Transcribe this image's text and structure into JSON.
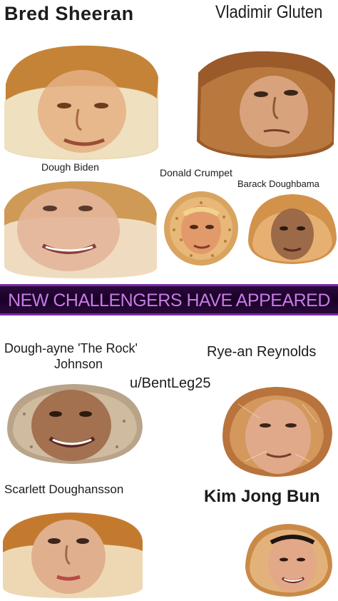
{
  "top": {
    "bred": "Bred Sheeran",
    "vladimir": "Vladimir Gluten",
    "dough_biden": "Dough Biden",
    "donald": "Donald Crumpet",
    "barack": "Barack Doughbama"
  },
  "banner": "NEW CHALLENGERS HAVE APPEARED",
  "bottom": {
    "rock_line1": "Dough-ayne 'The Rock'",
    "rock_line2": "Johnson",
    "ryan": "Rye-an Reynolds",
    "credit": "u/BentLeg25",
    "scarlett": "Scarlett Doughansson",
    "kim": "Kim Jong Bun"
  },
  "colors": {
    "crust": "#b9772f",
    "crumb": "#ecdcb8",
    "banner_text": "#c87ae8",
    "banner_bg": "#1a0026"
  }
}
